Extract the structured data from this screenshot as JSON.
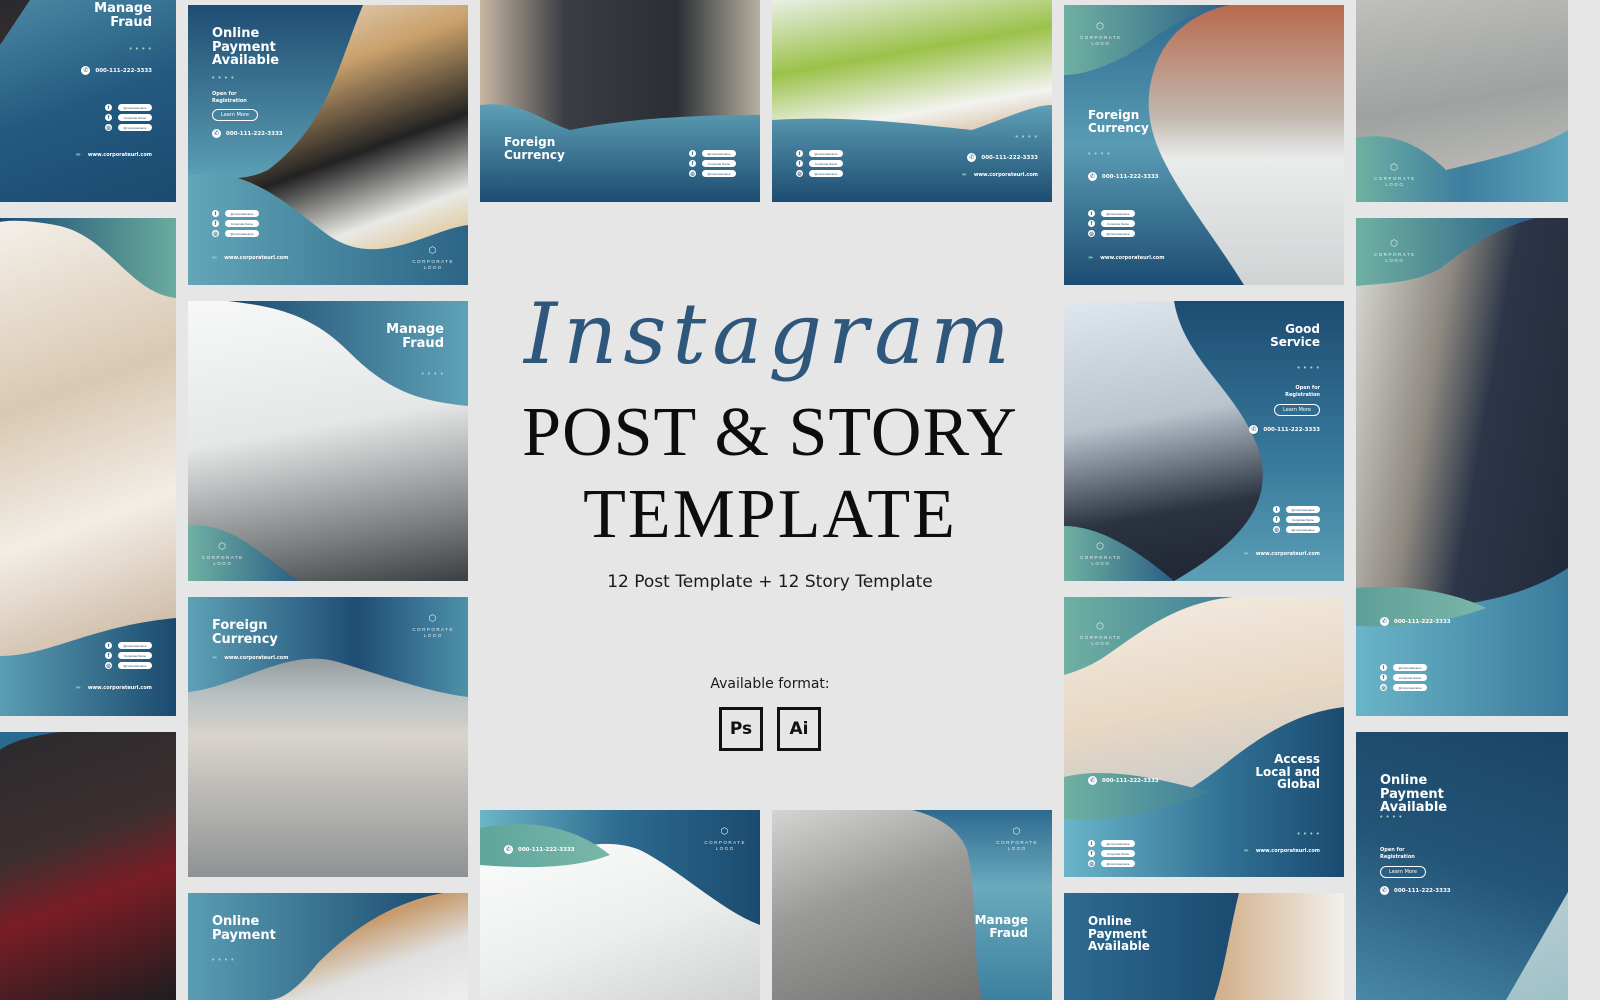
{
  "hero": {
    "script_title": "Instagram",
    "title_line1": "POST & STORY",
    "title_line2": "TEMPLATE",
    "subtitle": "12 Post Template + 12 Story Template",
    "formats_label": "Available format:",
    "formats": [
      "Ps",
      "Ai"
    ]
  },
  "common": {
    "phone": "000-111-222-3333",
    "url": "www.corporateurl.com",
    "url_arrows": "››››",
    "dots": "• • • •",
    "logo_top": "CORPORATE",
    "logo_bottom": "LOGO",
    "logo_glyph": "⬡",
    "social_handles": [
      "@corporatename",
      "Corporate Name",
      "@corporatename"
    ],
    "open_for": "Open for",
    "registration": "Registration",
    "learn_more": "Learn More"
  },
  "tiles": [
    {
      "id": "story-manage-fraud-left",
      "title": "Manage Fraud"
    },
    {
      "id": "post-online-payment-available",
      "title": "Online Payment Available"
    },
    {
      "id": "post-foreign-currency-top",
      "title": "Foreign Currency"
    },
    {
      "id": "post-chairs-top",
      "title": ""
    },
    {
      "id": "post-foreign-currency-right",
      "title": "Foreign Currency"
    },
    {
      "id": "story-floor-right",
      "title": ""
    },
    {
      "id": "story-laptop-left",
      "title": ""
    },
    {
      "id": "post-manage-fraud",
      "title": "Manage Fraud"
    },
    {
      "id": "post-good-service",
      "title": "Good Service"
    },
    {
      "id": "story-man-right",
      "title": ""
    },
    {
      "id": "post-foreign-currency-office",
      "title": "Foreign Currency"
    },
    {
      "id": "post-access-local-global",
      "title": "Access Local and Global"
    },
    {
      "id": "story-online-payment-right",
      "title": "Online Payment Available"
    },
    {
      "id": "post-dark-left",
      "title": ""
    },
    {
      "id": "post-desk-bottom",
      "title": ""
    },
    {
      "id": "post-manage-fraud-bottom",
      "title": "Manage Fraud"
    },
    {
      "id": "post-online-payment-bottom",
      "title": "Online Payment"
    },
    {
      "id": "post-online-payment-available-bottom",
      "title": "Online Payment Available"
    }
  ]
}
